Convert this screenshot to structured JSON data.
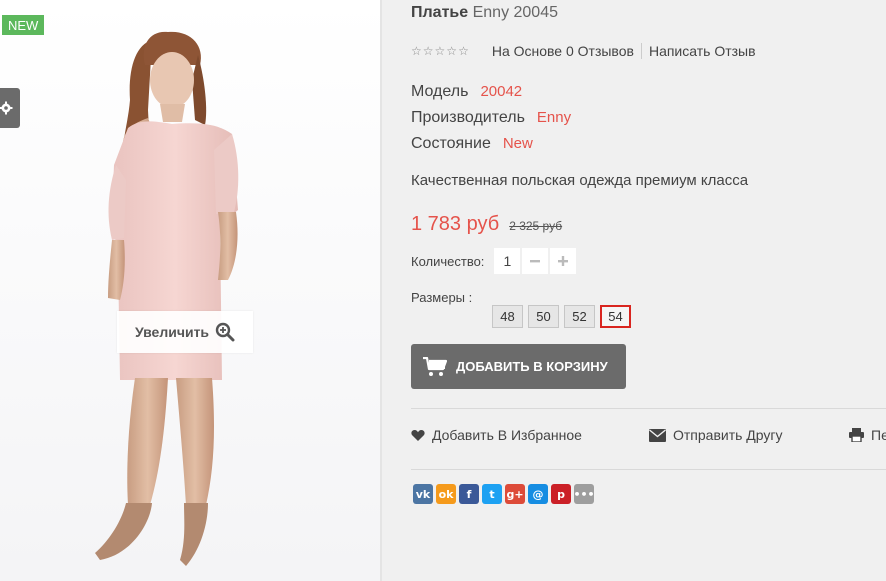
{
  "gallery": {
    "badge": "NEW",
    "zoom_label": "Увеличить"
  },
  "product": {
    "name": "Платье",
    "model_in_title": "Enny 20045",
    "rating": {
      "stars_filled": 0,
      "stars_total": 5,
      "reviews_link": "На Основе 0 Отзывов",
      "write_review_link": "Написать Отзыв"
    },
    "specs": [
      {
        "label": "Модель",
        "value": "20042"
      },
      {
        "label": "Производитель",
        "value": "Enny"
      },
      {
        "label": "Состояние",
        "value": "New"
      }
    ],
    "description": "Качественная польская одежда премиум класса",
    "price_new": "1 783 руб",
    "price_old": "2 325 руб",
    "quantity_label": "Количество:",
    "quantity_value": "1",
    "sizes_label": "Размеры :",
    "sizes": [
      "48",
      "50",
      "52",
      "54"
    ],
    "selected_size": "54",
    "add_to_cart": "ДОБАВИТЬ В КОРЗИНУ"
  },
  "actions": {
    "wishlist": "Добавить В Избранное",
    "send_friend": "Отправить Другу",
    "print": "Пе"
  },
  "social": [
    {
      "name": "vk-icon",
      "glyph": "vk",
      "color": "#4c75a3"
    },
    {
      "name": "odnoklassniki-icon",
      "glyph": "ok",
      "color": "#f59a1b"
    },
    {
      "name": "facebook-icon",
      "glyph": "f",
      "color": "#3b5998"
    },
    {
      "name": "twitter-icon",
      "glyph": "t",
      "color": "#1da1f2"
    },
    {
      "name": "googleplus-icon",
      "glyph": "g+",
      "color": "#dd4b39"
    },
    {
      "name": "mailru-icon",
      "glyph": "@",
      "color": "#168de2"
    },
    {
      "name": "pinterest-icon",
      "glyph": "p",
      "color": "#cb2027"
    },
    {
      "name": "more-icon",
      "glyph": "•••",
      "color": "#9e9e9e"
    }
  ],
  "colors": {
    "accent": "#e5534b",
    "badge_green": "#5cb85c",
    "button_gray": "#6b6b6b",
    "size_selected_border": "#d9251f"
  }
}
